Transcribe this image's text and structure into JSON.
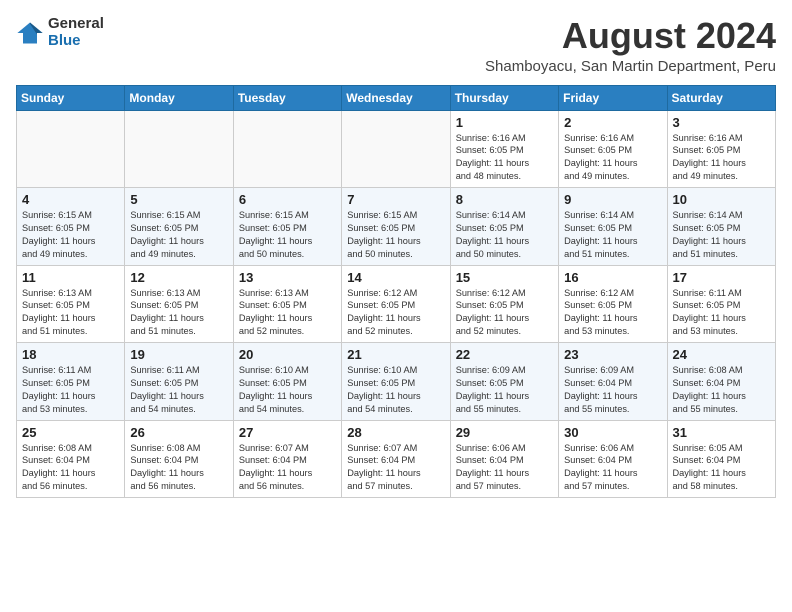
{
  "header": {
    "logo_general": "General",
    "logo_blue": "Blue",
    "month_year": "August 2024",
    "subtitle": "Shamboyacu, San Martin Department, Peru"
  },
  "weekdays": [
    "Sunday",
    "Monday",
    "Tuesday",
    "Wednesday",
    "Thursday",
    "Friday",
    "Saturday"
  ],
  "weeks": [
    [
      {
        "day": "",
        "info": ""
      },
      {
        "day": "",
        "info": ""
      },
      {
        "day": "",
        "info": ""
      },
      {
        "day": "",
        "info": ""
      },
      {
        "day": "1",
        "info": "Sunrise: 6:16 AM\nSunset: 6:05 PM\nDaylight: 11 hours\nand 48 minutes."
      },
      {
        "day": "2",
        "info": "Sunrise: 6:16 AM\nSunset: 6:05 PM\nDaylight: 11 hours\nand 49 minutes."
      },
      {
        "day": "3",
        "info": "Sunrise: 6:16 AM\nSunset: 6:05 PM\nDaylight: 11 hours\nand 49 minutes."
      }
    ],
    [
      {
        "day": "4",
        "info": "Sunrise: 6:15 AM\nSunset: 6:05 PM\nDaylight: 11 hours\nand 49 minutes."
      },
      {
        "day": "5",
        "info": "Sunrise: 6:15 AM\nSunset: 6:05 PM\nDaylight: 11 hours\nand 49 minutes."
      },
      {
        "day": "6",
        "info": "Sunrise: 6:15 AM\nSunset: 6:05 PM\nDaylight: 11 hours\nand 50 minutes."
      },
      {
        "day": "7",
        "info": "Sunrise: 6:15 AM\nSunset: 6:05 PM\nDaylight: 11 hours\nand 50 minutes."
      },
      {
        "day": "8",
        "info": "Sunrise: 6:14 AM\nSunset: 6:05 PM\nDaylight: 11 hours\nand 50 minutes."
      },
      {
        "day": "9",
        "info": "Sunrise: 6:14 AM\nSunset: 6:05 PM\nDaylight: 11 hours\nand 51 minutes."
      },
      {
        "day": "10",
        "info": "Sunrise: 6:14 AM\nSunset: 6:05 PM\nDaylight: 11 hours\nand 51 minutes."
      }
    ],
    [
      {
        "day": "11",
        "info": "Sunrise: 6:13 AM\nSunset: 6:05 PM\nDaylight: 11 hours\nand 51 minutes."
      },
      {
        "day": "12",
        "info": "Sunrise: 6:13 AM\nSunset: 6:05 PM\nDaylight: 11 hours\nand 51 minutes."
      },
      {
        "day": "13",
        "info": "Sunrise: 6:13 AM\nSunset: 6:05 PM\nDaylight: 11 hours\nand 52 minutes."
      },
      {
        "day": "14",
        "info": "Sunrise: 6:12 AM\nSunset: 6:05 PM\nDaylight: 11 hours\nand 52 minutes."
      },
      {
        "day": "15",
        "info": "Sunrise: 6:12 AM\nSunset: 6:05 PM\nDaylight: 11 hours\nand 52 minutes."
      },
      {
        "day": "16",
        "info": "Sunrise: 6:12 AM\nSunset: 6:05 PM\nDaylight: 11 hours\nand 53 minutes."
      },
      {
        "day": "17",
        "info": "Sunrise: 6:11 AM\nSunset: 6:05 PM\nDaylight: 11 hours\nand 53 minutes."
      }
    ],
    [
      {
        "day": "18",
        "info": "Sunrise: 6:11 AM\nSunset: 6:05 PM\nDaylight: 11 hours\nand 53 minutes."
      },
      {
        "day": "19",
        "info": "Sunrise: 6:11 AM\nSunset: 6:05 PM\nDaylight: 11 hours\nand 54 minutes."
      },
      {
        "day": "20",
        "info": "Sunrise: 6:10 AM\nSunset: 6:05 PM\nDaylight: 11 hours\nand 54 minutes."
      },
      {
        "day": "21",
        "info": "Sunrise: 6:10 AM\nSunset: 6:05 PM\nDaylight: 11 hours\nand 54 minutes."
      },
      {
        "day": "22",
        "info": "Sunrise: 6:09 AM\nSunset: 6:05 PM\nDaylight: 11 hours\nand 55 minutes."
      },
      {
        "day": "23",
        "info": "Sunrise: 6:09 AM\nSunset: 6:04 PM\nDaylight: 11 hours\nand 55 minutes."
      },
      {
        "day": "24",
        "info": "Sunrise: 6:08 AM\nSunset: 6:04 PM\nDaylight: 11 hours\nand 55 minutes."
      }
    ],
    [
      {
        "day": "25",
        "info": "Sunrise: 6:08 AM\nSunset: 6:04 PM\nDaylight: 11 hours\nand 56 minutes."
      },
      {
        "day": "26",
        "info": "Sunrise: 6:08 AM\nSunset: 6:04 PM\nDaylight: 11 hours\nand 56 minutes."
      },
      {
        "day": "27",
        "info": "Sunrise: 6:07 AM\nSunset: 6:04 PM\nDaylight: 11 hours\nand 56 minutes."
      },
      {
        "day": "28",
        "info": "Sunrise: 6:07 AM\nSunset: 6:04 PM\nDaylight: 11 hours\nand 57 minutes."
      },
      {
        "day": "29",
        "info": "Sunrise: 6:06 AM\nSunset: 6:04 PM\nDaylight: 11 hours\nand 57 minutes."
      },
      {
        "day": "30",
        "info": "Sunrise: 6:06 AM\nSunset: 6:04 PM\nDaylight: 11 hours\nand 57 minutes."
      },
      {
        "day": "31",
        "info": "Sunrise: 6:05 AM\nSunset: 6:04 PM\nDaylight: 11 hours\nand 58 minutes."
      }
    ]
  ]
}
